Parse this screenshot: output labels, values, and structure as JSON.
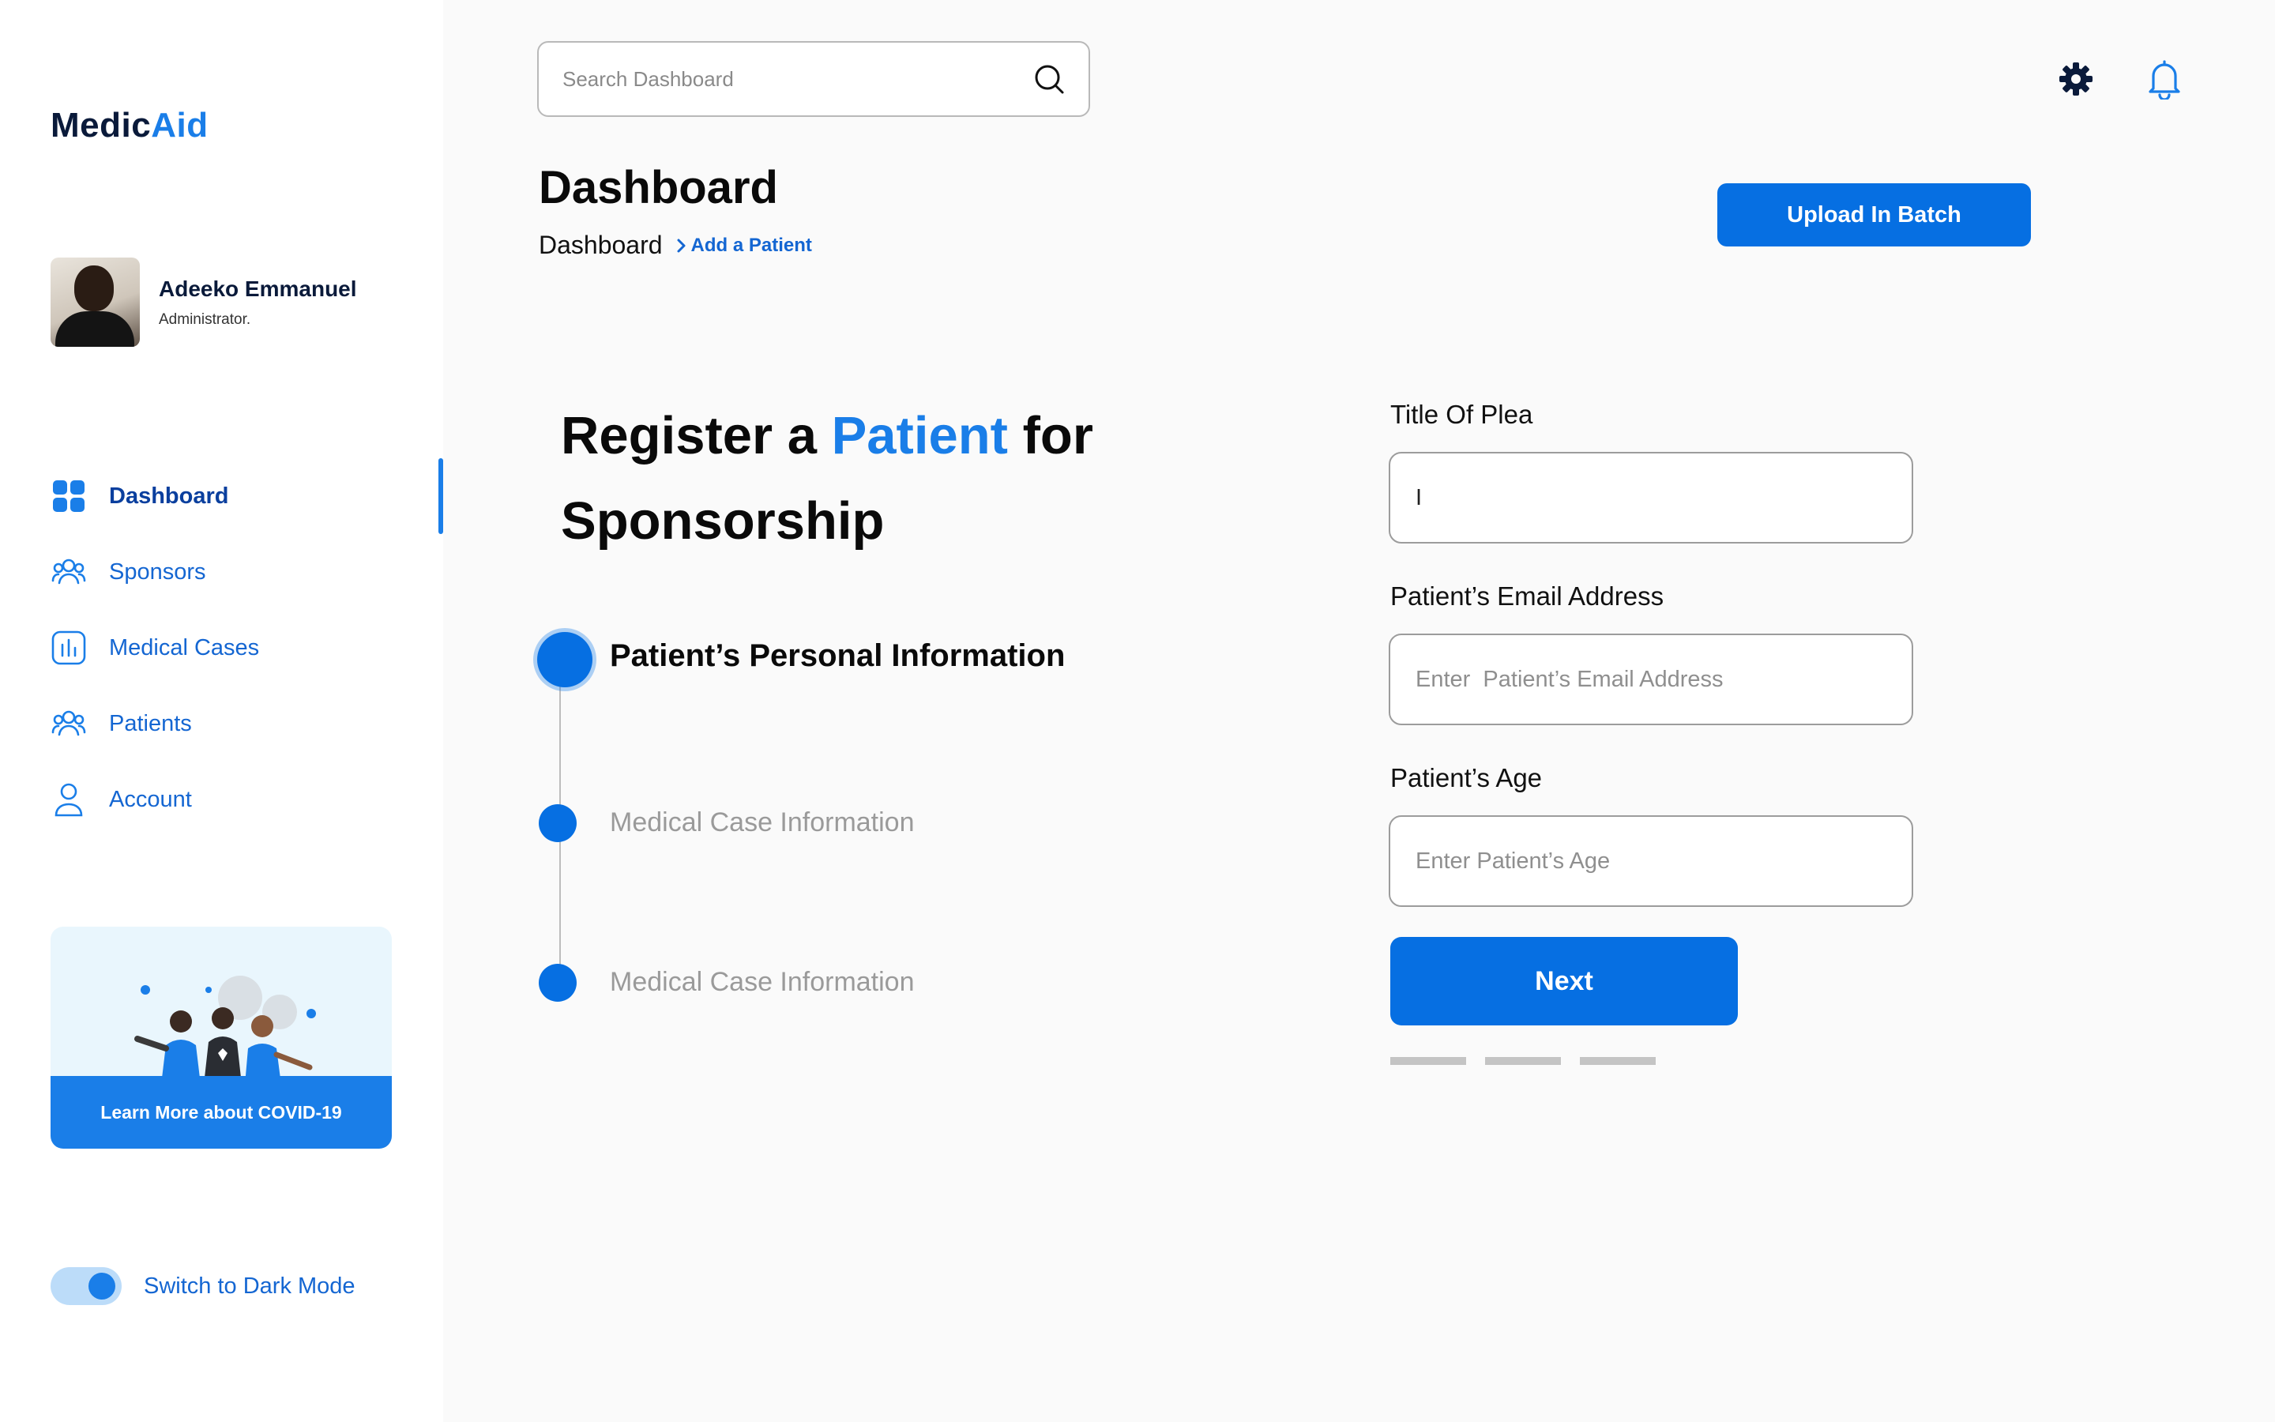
{
  "app": {
    "logo_part1": "Medic",
    "logo_part2": "Aid"
  },
  "profile": {
    "name": "Adeeko Emmanuel",
    "role": "Administrator."
  },
  "sidebar": {
    "items": [
      {
        "label": "Dashboard",
        "icon": "grid-icon",
        "active": true
      },
      {
        "label": "Sponsors",
        "icon": "users-icon"
      },
      {
        "label": "Medical Cases",
        "icon": "chart-icon"
      },
      {
        "label": "Patients",
        "icon": "users-icon"
      },
      {
        "label": "Account",
        "icon": "user-icon"
      }
    ],
    "covid_button": "Learn More about COVID-19",
    "dark_mode_label": "Switch to Dark Mode"
  },
  "search": {
    "placeholder": "Search Dashboard"
  },
  "header": {
    "title": "Dashboard",
    "breadcrumb_root": "Dashboard",
    "breadcrumb_current": "Add a Patient",
    "upload_button": "Upload In Batch"
  },
  "register": {
    "heading_part1": "Register a ",
    "heading_highlight": "Patient",
    "heading_part2": " for Sponsorship"
  },
  "steps": [
    {
      "label": "Patient’s Personal Information",
      "active": true
    },
    {
      "label": "Medical Case Information"
    },
    {
      "label": "Medical Case Information"
    }
  ],
  "form": {
    "title_label": "Title Of Plea",
    "title_value": "I",
    "email_label": "Patient’s Email Address",
    "email_placeholder": "Enter  Patient’s Email Address",
    "age_label": "Patient’s Age",
    "age_placeholder": "Enter Patient’s Age",
    "next_button": "Next"
  },
  "colors": {
    "accent": "#1a7ee8",
    "primary_button": "#066fe2",
    "nav_text": "#1466d2"
  }
}
